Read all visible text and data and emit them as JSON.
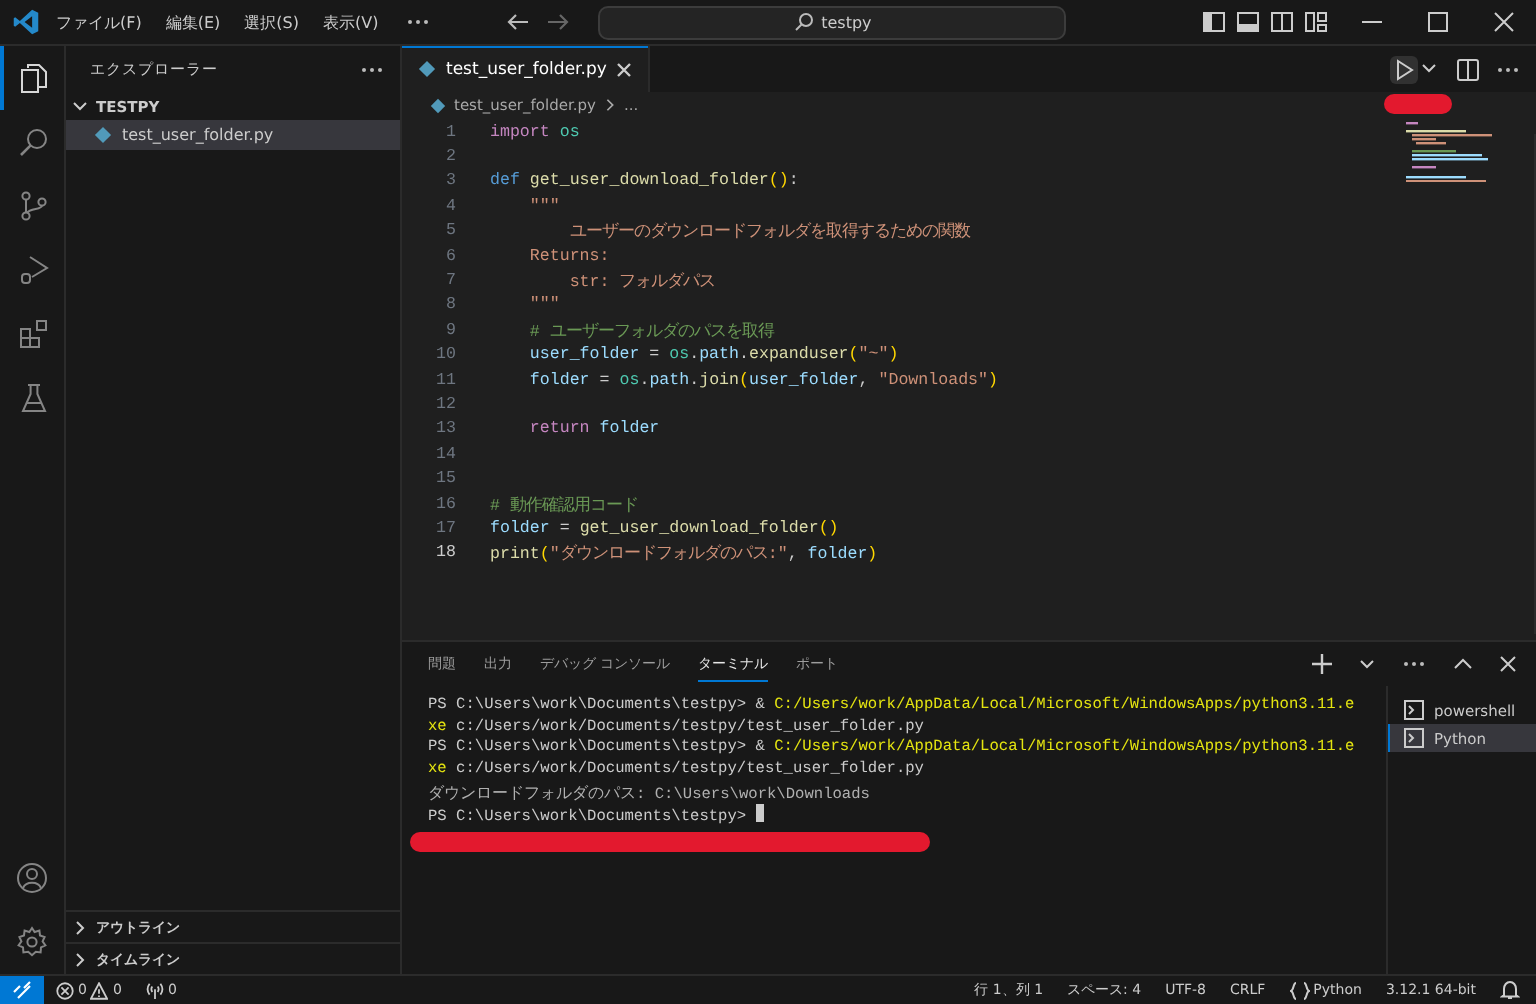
{
  "menu": [
    "ファイル(F)",
    "編集(E)",
    "選択(S)",
    "表示(V)"
  ],
  "search": {
    "value": "testpy"
  },
  "activity_bar": [
    {
      "kind": "explorer",
      "selected": true
    },
    {
      "kind": "search",
      "selected": false
    },
    {
      "kind": "source-control",
      "selected": false
    },
    {
      "kind": "run-debug",
      "selected": false
    },
    {
      "kind": "extensions",
      "selected": false
    },
    {
      "kind": "testing",
      "selected": false
    }
  ],
  "sidebar": {
    "title": "エクスプローラー",
    "folder": {
      "name": "TESTPY",
      "expanded": true,
      "files": [
        {
          "name": "test_user_folder.py",
          "selected": true
        }
      ]
    },
    "sections": [
      {
        "name": "アウトライン",
        "expanded": false
      },
      {
        "name": "タイムライン",
        "expanded": false
      }
    ]
  },
  "tabs": [
    {
      "label": "test_user_folder.py",
      "selected": true
    }
  ],
  "breadcrumb": {
    "file": "test_user_folder.py",
    "tail": "..."
  },
  "code": [
    {
      "number": "1",
      "active": false,
      "tokens": [
        {
          "kind": "keyword",
          "text": "import"
        },
        {
          "kind": "module",
          "text": " os"
        }
      ]
    },
    {
      "number": "2",
      "active": false
    },
    {
      "number": "3",
      "active": false,
      "tokens": [
        {
          "kind": "def",
          "text": "def"
        },
        {
          "kind": "function",
          "text": " get_user_download_folder"
        },
        {
          "kind": "bracket",
          "text": "()"
        },
        {
          "kind": "plain",
          "text": ":"
        }
      ]
    },
    {
      "number": "4",
      "active": false,
      "tokens": [
        {
          "kind": "string",
          "text": "    \"\"\""
        }
      ]
    },
    {
      "number": "5",
      "active": false,
      "tokens": [
        {
          "kind": "string",
          "text": "        ユーザーのダウンロードフォルダを取得するための関数"
        }
      ]
    },
    {
      "number": "6",
      "active": false,
      "tokens": [
        {
          "kind": "string",
          "text": "    Returns:"
        }
      ]
    },
    {
      "number": "7",
      "active": false,
      "tokens": [
        {
          "kind": "string",
          "text": "        str: フォルダパス"
        }
      ]
    },
    {
      "number": "8",
      "active": false,
      "tokens": [
        {
          "kind": "string",
          "text": "    \"\"\""
        }
      ]
    },
    {
      "number": "9",
      "active": false,
      "tokens": [
        {
          "kind": "comment",
          "text": "    # ユーザーフォルダのパスを取得"
        }
      ]
    },
    {
      "number": "10",
      "active": false,
      "tokens": [
        {
          "kind": "variable",
          "text": "    user_folder"
        },
        {
          "kind": "plain",
          "text": " = "
        },
        {
          "kind": "module",
          "text": "os"
        },
        {
          "kind": "plain",
          "text": "."
        },
        {
          "kind": "variable",
          "text": "path"
        },
        {
          "kind": "plain",
          "text": "."
        },
        {
          "kind": "function",
          "text": "expanduser"
        },
        {
          "kind": "bracket",
          "text": "("
        },
        {
          "kind": "string",
          "text": "\"~\""
        },
        {
          "kind": "bracket",
          "text": ")"
        }
      ]
    },
    {
      "number": "11",
      "active": false,
      "tokens": [
        {
          "kind": "variable",
          "text": "    folder"
        },
        {
          "kind": "plain",
          "text": " = "
        },
        {
          "kind": "module",
          "text": "os"
        },
        {
          "kind": "plain",
          "text": "."
        },
        {
          "kind": "variable",
          "text": "path"
        },
        {
          "kind": "plain",
          "text": "."
        },
        {
          "kind": "function",
          "text": "join"
        },
        {
          "kind": "bracket",
          "text": "("
        },
        {
          "kind": "variable",
          "text": "user_folder"
        },
        {
          "kind": "plain",
          "text": ", "
        },
        {
          "kind": "string",
          "text": "\"Downloads\""
        },
        {
          "kind": "bracket",
          "text": ")"
        }
      ]
    },
    {
      "number": "12",
      "active": false
    },
    {
      "number": "13",
      "active": false,
      "tokens": [
        {
          "kind": "keyword",
          "text": "    return"
        },
        {
          "kind": "variable",
          "text": " folder"
        }
      ]
    },
    {
      "number": "14",
      "active": false
    },
    {
      "number": "15",
      "active": false
    },
    {
      "number": "16",
      "active": false,
      "tokens": [
        {
          "kind": "comment",
          "text": "# 動作確認用コード"
        }
      ]
    },
    {
      "number": "17",
      "active": false,
      "tokens": [
        {
          "kind": "variable",
          "text": "folder"
        },
        {
          "kind": "plain",
          "text": " = "
        },
        {
          "kind": "function",
          "text": "get_user_download_folder"
        },
        {
          "kind": "bracket",
          "text": "()"
        }
      ]
    },
    {
      "number": "18",
      "active": true,
      "tokens": [
        {
          "kind": "function",
          "text": "print"
        },
        {
          "kind": "bracket",
          "text": "("
        },
        {
          "kind": "string",
          "text": "\"ダウンロードフォルダのパス:\""
        },
        {
          "kind": "plain",
          "text": ", "
        },
        {
          "kind": "variable",
          "text": "folder"
        },
        {
          "kind": "bracket",
          "text": ")"
        }
      ]
    }
  ],
  "panel": {
    "tabs": [
      {
        "label": "問題",
        "selected": false
      },
      {
        "label": "出力",
        "selected": false
      },
      {
        "label": "デバッグ コンソール",
        "selected": false
      },
      {
        "label": "ターミナル",
        "selected": true
      },
      {
        "label": "ポート",
        "selected": false
      }
    ],
    "terminal": [
      {
        "cursor": false,
        "segments": [
          {
            "kind": "plain",
            "text": "PS C:\\Users\\work\\Documents\\testpy> & "
          },
          {
            "kind": "path",
            "text": "C:/Users/work/AppData/Local/Microsoft/WindowsApps/python3.11.e"
          }
        ]
      },
      {
        "cursor": false,
        "segments": [
          {
            "kind": "path",
            "text": "xe"
          },
          {
            "kind": "plain",
            "text": " c:/Users/work/Documents/testpy/test_user_folder.py"
          }
        ]
      },
      {
        "cursor": false,
        "segments": [
          {
            "kind": "plain",
            "text": "PS C:\\Users\\work\\Documents\\testpy> & "
          },
          {
            "kind": "path",
            "text": "C:/Users/work/AppData/Local/Microsoft/WindowsApps/python3.11.e"
          }
        ]
      },
      {
        "cursor": false,
        "segments": [
          {
            "kind": "path",
            "text": "xe"
          },
          {
            "kind": "plain",
            "text": " c:/Users/work/Documents/testpy/test_user_folder.py"
          }
        ]
      },
      {
        "cursor": false,
        "segments": [
          {
            "kind": "output",
            "text": "ダウンロードフォルダのパス: C:\\Users\\work\\Downloads"
          }
        ]
      },
      {
        "cursor": true,
        "segments": [
          {
            "kind": "plain",
            "text": "PS C:\\Users\\work\\Documents\\testpy>"
          }
        ]
      }
    ],
    "terminals": [
      {
        "name": "powershell",
        "selected": false
      },
      {
        "name": "Python",
        "selected": true
      }
    ]
  },
  "status_bar": {
    "errors": "0",
    "warnings": "0",
    "ports": "0",
    "position": "行 1、列 1",
    "spaces": "スペース: 4",
    "encoding": "UTF-8",
    "eol": "CRLF",
    "language": "Python",
    "interpreter": "3.12.1 64-bit"
  }
}
